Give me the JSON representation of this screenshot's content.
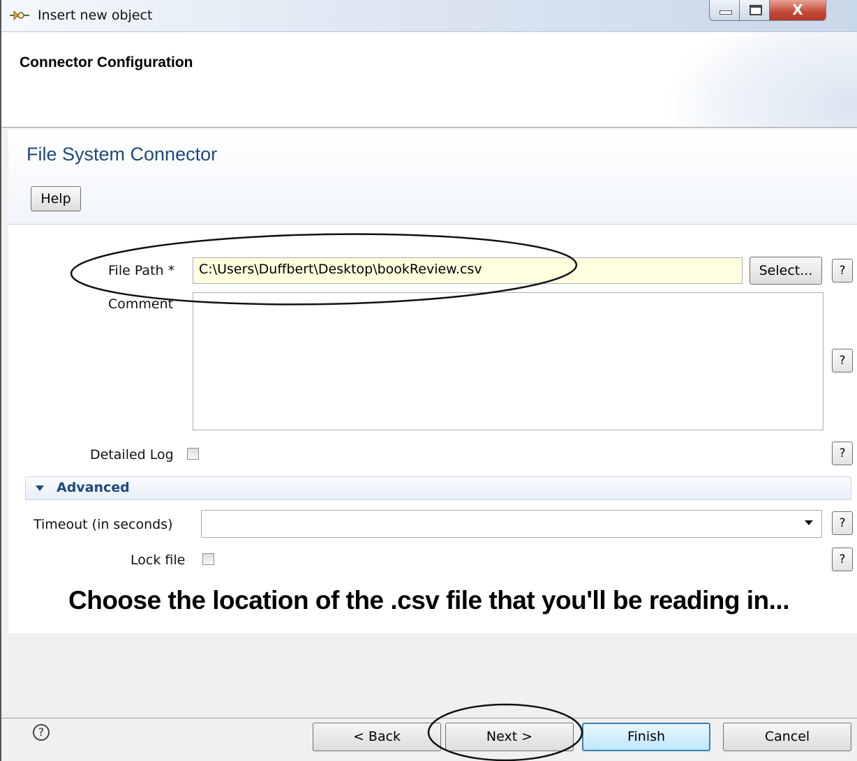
{
  "window": {
    "title": "Insert new object",
    "controls": {
      "minimize": "",
      "maximize": "",
      "close": "X"
    }
  },
  "header": {
    "title": "Connector Configuration"
  },
  "panel": {
    "title": "File System Connector",
    "help_button": "Help"
  },
  "form": {
    "file_path": {
      "label": "File Path *",
      "value": "C:\\Users\\Duffbert\\Desktop\\bookReview.csv",
      "select_button": "Select..."
    },
    "comment": {
      "label": "Comment",
      "value": ""
    },
    "detailed_log": {
      "label": "Detailed Log",
      "checked": false
    },
    "help_glyph": "?"
  },
  "advanced": {
    "label": "Advanced",
    "timeout": {
      "label": "Timeout (in seconds)",
      "value": ""
    },
    "lock_file": {
      "label": "Lock file",
      "checked": false
    }
  },
  "caption": "Choose the location of the .csv file that you'll be reading in...",
  "footer": {
    "help_icon": "?",
    "back": "< Back",
    "next": "Next >",
    "finish": "Finish",
    "cancel": "Cancel"
  }
}
